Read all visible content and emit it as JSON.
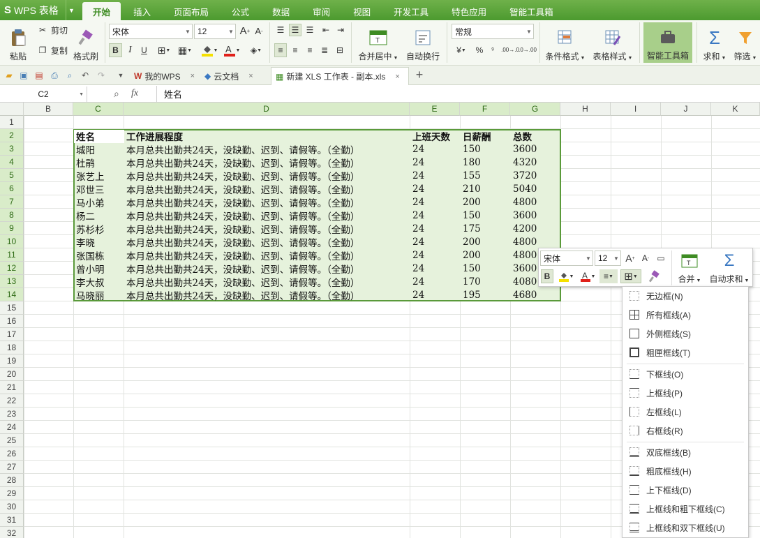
{
  "app": {
    "title": "WPS 表格",
    "logo": "S"
  },
  "menu_tabs": [
    "开始",
    "插入",
    "页面布局",
    "公式",
    "数据",
    "审阅",
    "视图",
    "开发工具",
    "特色应用",
    "智能工具箱"
  ],
  "ribbon": {
    "paste": "粘贴",
    "cut": "剪切",
    "copy": "复制",
    "format_painter": "格式刷",
    "font_name": "宋体",
    "font_size": "12",
    "bold": "B",
    "italic": "I",
    "underline": "U",
    "merge_center": "合并居中",
    "wrap_text": "自动换行",
    "number_format": "常规",
    "percent": "%",
    "thousands": "⁹",
    "inc_decimal": ".00→.0",
    "dec_decimal": ".0→.00",
    "cond_format": "条件格式",
    "table_style": "表格样式",
    "smart_toolbox": "智能工具箱",
    "sum": "求和",
    "filter": "筛选"
  },
  "doc_tabs": [
    {
      "label": "我的WPS"
    },
    {
      "label": "云文档"
    },
    {
      "label": "新建 XLS 工作表 - 副本.xls"
    }
  ],
  "formula_bar": {
    "cell_ref": "C2",
    "fx": "fx",
    "value": "姓名"
  },
  "columns": [
    "B",
    "C",
    "D",
    "E",
    "F",
    "G",
    "H",
    "I",
    "J",
    "K"
  ],
  "rows": [
    "1",
    "2",
    "3",
    "4",
    "5",
    "6",
    "7",
    "8",
    "9",
    "10",
    "11",
    "12",
    "13",
    "14",
    "15",
    "16",
    "17",
    "18",
    "19",
    "20",
    "21",
    "22",
    "23",
    "24",
    "25",
    "26",
    "27",
    "28",
    "29",
    "30",
    "31",
    "32"
  ],
  "table": {
    "headers": [
      "姓名",
      "工作进展程度",
      "上班天数",
      "日薪酬",
      "总数"
    ],
    "rows": [
      [
        "城阳",
        "本月总共出勤共24天，没缺勤、迟到、请假等。（全勤）",
        "24",
        "150",
        "3600"
      ],
      [
        "杜鹃",
        "本月总共出勤共24天，没缺勤、迟到、请假等。（全勤）",
        "24",
        "180",
        "4320"
      ],
      [
        "张艺上",
        "本月总共出勤共24天，没缺勤、迟到、请假等。（全勤）",
        "24",
        "155",
        "3720"
      ],
      [
        "邓世三",
        "本月总共出勤共24天，没缺勤、迟到、请假等。（全勤）",
        "24",
        "210",
        "5040"
      ],
      [
        "马小弟",
        "本月总共出勤共24天，没缺勤、迟到、请假等。（全勤）",
        "24",
        "200",
        "4800"
      ],
      [
        "杨二",
        "本月总共出勤共24天，没缺勤、迟到、请假等。（全勤）",
        "24",
        "150",
        "3600"
      ],
      [
        "苏杉杉",
        "本月总共出勤共24天，没缺勤、迟到、请假等。（全勤）",
        "24",
        "175",
        "4200"
      ],
      [
        "李晓",
        "本月总共出勤共24天，没缺勤、迟到、请假等。（全勤）",
        "24",
        "200",
        "4800"
      ],
      [
        "张国栋",
        "本月总共出勤共24天，没缺勤、迟到、请假等。（全勤）",
        "24",
        "200",
        "4800"
      ],
      [
        "曾小明",
        "本月总共出勤共24天，没缺勤、迟到、请假等。（全勤）",
        "24",
        "150",
        "3600"
      ],
      [
        "李大叔",
        "本月总共出勤共24天，没缺勤、迟到、请假等。（全勤）",
        "24",
        "170",
        "4080"
      ],
      [
        "马晓丽",
        "本月总共出勤共24天，没缺勤、迟到、请假等。（全勤）",
        "24",
        "195",
        "4680"
      ]
    ]
  },
  "mini_toolbar": {
    "font_name": "宋体",
    "font_size": "12",
    "bold": "B",
    "merge": "合并",
    "autosum": "自动求和"
  },
  "border_menu": {
    "items": [
      "无边框(N)",
      "所有框线(A)",
      "外侧框线(S)",
      "粗匣框线(T)",
      "下框线(O)",
      "上框线(P)",
      "左框线(L)",
      "右框线(R)",
      "双底框线(B)",
      "粗底框线(H)",
      "上下框线(D)",
      "上框线和粗下框线(C)",
      "上框线和双下框线(U)"
    ]
  },
  "colors": {
    "accent": "#4c9a2f",
    "selection": "#e6f2dc",
    "selection_border": "#5a9a3a"
  }
}
